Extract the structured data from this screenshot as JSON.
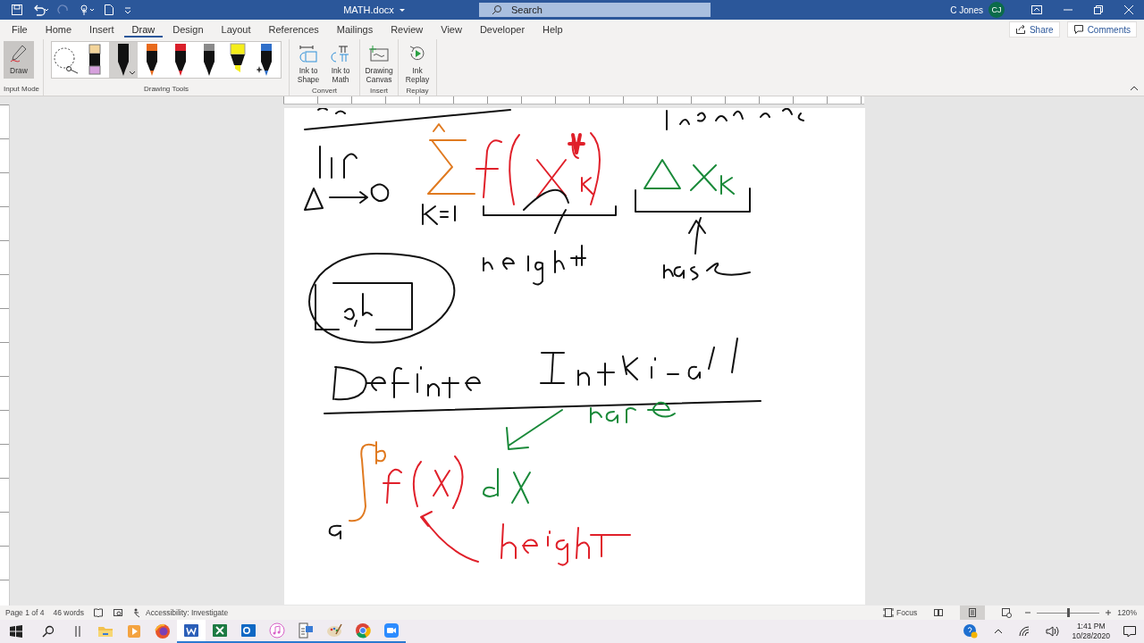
{
  "title_bar": {
    "document_title": "MATH.docx",
    "search": {
      "placeholder": "Search"
    },
    "user": "C Jones",
    "avatar": "CJ"
  },
  "tabs": [
    {
      "label": "File",
      "selected": false
    },
    {
      "label": "Home",
      "selected": false
    },
    {
      "label": "Insert",
      "selected": false
    },
    {
      "label": "Draw",
      "selected": true
    },
    {
      "label": "Design",
      "selected": false
    },
    {
      "label": "Layout",
      "selected": false
    },
    {
      "label": "References",
      "selected": false
    },
    {
      "label": "Mailings",
      "selected": false
    },
    {
      "label": "Review",
      "selected": false
    },
    {
      "label": "View",
      "selected": false
    },
    {
      "label": "Developer",
      "selected": false
    },
    {
      "label": "Help",
      "selected": false
    }
  ],
  "share": "Share",
  "comments": "Comments",
  "ribbon": {
    "input_mode": {
      "button": {
        "label": "Draw",
        "selected": true
      },
      "group_label": "Input Mode"
    },
    "drawing_tools": {
      "group_label": "Drawing Tools",
      "tools": [
        {
          "kind": "lasso",
          "selected": false
        },
        {
          "kind": "eraser",
          "selected": false
        },
        {
          "kind": "pen",
          "color": "#111111",
          "selected": true
        },
        {
          "kind": "pen",
          "color": "#e86a1c",
          "selected": false
        },
        {
          "kind": "pen",
          "color": "#d9202a",
          "selected": false
        },
        {
          "kind": "pencil",
          "color": "#8a8a8a",
          "selected": false
        },
        {
          "kind": "highlighter",
          "color": "#f5ee1a",
          "selected": false
        },
        {
          "kind": "galaxy",
          "color": "#2f6fc9",
          "selected": false
        }
      ]
    },
    "groups": [
      {
        "label": "Convert",
        "buttons": [
          {
            "kind": "shape",
            "label": "Ink to Shape"
          },
          {
            "kind": "math",
            "label": "Ink to Math"
          }
        ]
      },
      {
        "label": "Insert",
        "buttons": [
          {
            "kind": "canvas",
            "label": "Drawing Canvas"
          }
        ]
      },
      {
        "label": "Replay",
        "buttons": [
          {
            "kind": "replay",
            "label": "Ink Replay"
          }
        ]
      }
    ]
  },
  "status_bar": {
    "page": "Page 1 of 4",
    "words": "46 words",
    "accessibility": "Accessibility: Investigate",
    "focus": "Focus",
    "views": [
      {
        "kind": "read",
        "selected": false
      },
      {
        "kind": "print",
        "selected": true
      },
      {
        "kind": "web",
        "selected": false
      }
    ],
    "zoom": {
      "level": 0.5,
      "reading": "120%"
    }
  },
  "taskbar": {
    "apps": [
      {
        "kind": "explorer",
        "running": false,
        "selected": false
      },
      {
        "kind": "media",
        "running": false,
        "selected": false
      },
      {
        "kind": "firefox",
        "running": false,
        "selected": false
      },
      {
        "kind": "word",
        "running": true,
        "selected": true
      },
      {
        "kind": "excel",
        "running": true,
        "selected": false
      },
      {
        "kind": "outlook",
        "running": true,
        "selected": false
      },
      {
        "kind": "music",
        "running": true,
        "selected": false
      },
      {
        "kind": "calc",
        "running": true,
        "selected": false
      },
      {
        "kind": "paint",
        "running": true,
        "selected": false
      },
      {
        "kind": "chrome",
        "running": true,
        "selected": false
      },
      {
        "kind": "zoom",
        "running": true,
        "selected": false
      }
    ],
    "time": "1:41 PM",
    "date": "10/28/2020"
  }
}
